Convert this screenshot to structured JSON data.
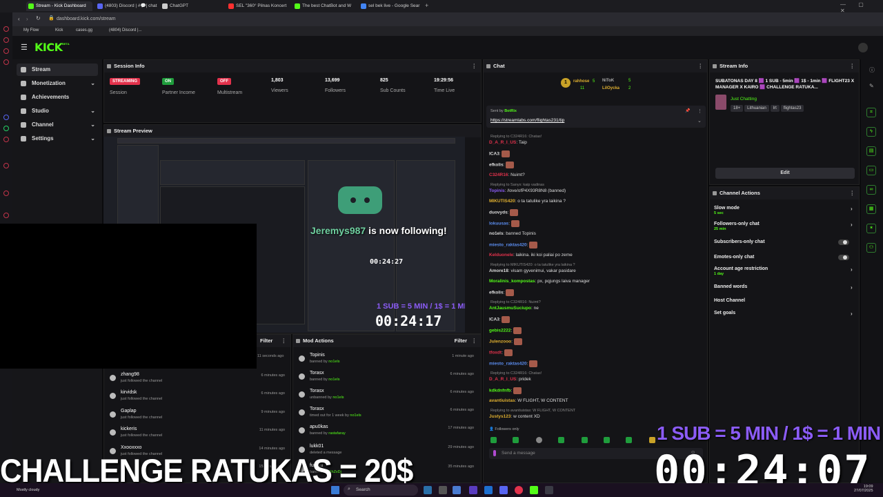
{
  "browser": {
    "tabs": [
      {
        "label": "Stream - Kick Dashboard",
        "active": true,
        "color": "#53fc18"
      },
      {
        "label": "(4803) Discord | #💬| chat",
        "active": false,
        "color": "#5865f2"
      },
      {
        "label": "ChatGPT",
        "active": false,
        "color": "#cccccc"
      },
      {
        "label": "SEL \"360° Pilnas Koncert",
        "active": false,
        "color": "#ff3030"
      },
      {
        "label": "The best ChatBot and W",
        "active": false,
        "color": "#53fc18"
      },
      {
        "label": "sel bek live - Google Sear",
        "active": false,
        "color": "#4285f4"
      }
    ],
    "url": "dashboard.kick.com/stream",
    "bookmarks": [
      "My Flow",
      "Kick",
      "cases.gg",
      "(4804) Discord |..."
    ]
  },
  "header": {
    "logo": "KICK",
    "logo_sup": "BETA"
  },
  "nav": {
    "items": [
      {
        "label": "Stream",
        "active": true,
        "chevron": false
      },
      {
        "label": "Monetization",
        "active": false,
        "chevron": true
      },
      {
        "label": "Achievements",
        "active": false,
        "chevron": false
      },
      {
        "label": "Studio",
        "active": false,
        "chevron": true
      },
      {
        "label": "Channel",
        "active": false,
        "chevron": true
      },
      {
        "label": "Settings",
        "active": false,
        "chevron": true
      }
    ]
  },
  "session": {
    "title": "Session Info",
    "stats": [
      {
        "badge": "STREAMING",
        "badge_color": "#e3324c",
        "label": "Session"
      },
      {
        "badge": "ON",
        "badge_color": "#1f9d3c",
        "label": "Partner Income"
      },
      {
        "badge": "OFF",
        "badge_color": "#e3324c",
        "label": "Multistream"
      },
      {
        "value": "1,803",
        "label": "Viewers"
      },
      {
        "value": "13,699",
        "label": "Followers"
      },
      {
        "value": "825",
        "label": "Sub Counts"
      },
      {
        "value": "19:29:56",
        "label": "Time Live"
      }
    ]
  },
  "preview": {
    "title": "Stream Preview",
    "alert_user": "Jeremys987",
    "alert_text": "is now following!",
    "alert_time": "00:24:27",
    "rule": "1 SUB = 5 MIN / 1$ = 1 MIN",
    "timer": "00:24:17"
  },
  "chat": {
    "title": "Chat",
    "top_users": [
      {
        "name": "rahhose",
        "count": "5"
      },
      {
        "name": "NiToK",
        "count": "5"
      },
      {
        "name": "",
        "count": "11"
      },
      {
        "name": "LilOycka",
        "count": "2"
      }
    ],
    "pinned": {
      "sent_by": "Sent by",
      "sender": "BotRix",
      "link": "https://streamlabs.com/flightas231/tip"
    },
    "messages": [
      {
        "reply": "Replying to C324R16: Chatas!",
        "user": "D_A_R_I_US",
        "color": "#e3324c",
        "text": "Taip"
      },
      {
        "user": "ICA3",
        "color": "#dddddd",
        "text": ""
      },
      {
        "user": "efkolis",
        "color": "#dddddd",
        "text": ""
      },
      {
        "user": "C324R16",
        "color": "#e3324c",
        "text": "Nuimt?"
      },
      {
        "reply": "Replying to Sanyx: kaip vadinas",
        "user": "Topinis",
        "color": "#8b5cf6",
        "text": "/love/ofP4X93R8N8 (banned)"
      },
      {
        "user": "MIKUTIS420",
        "color": "#e0b030",
        "text": "o ta tatulike yra laikina ?"
      },
      {
        "user": "duovyds",
        "color": "#dddddd",
        "text": ""
      },
      {
        "user": "lokuusas",
        "color": "#5b8def",
        "text": ""
      },
      {
        "user": "no1els",
        "color": "#dddddd",
        "text": "banned Topinis"
      },
      {
        "user": "miesto_raktas420",
        "color": "#5b8def",
        "text": ""
      },
      {
        "user": "Kelduonele",
        "color": "#e3324c",
        "text": "laikina. iki koi paliai po zeme"
      },
      {
        "reply": "Replying to MIKUTIS420: o ta tatulike yra laikina ?",
        "user": "Amore18",
        "color": "#dddddd",
        "text": "visam gyvenimui, vakar pasidare"
      },
      {
        "user": "Moralinis_kompostas",
        "color": "#53fc18",
        "text": "px, pqjungs laiva manager"
      },
      {
        "user": "efkolis",
        "color": "#dddddd",
        "text": ""
      },
      {
        "reply": "Replying to C324R16: Nuimt?",
        "user": "AntJausmuSuciupo",
        "color": "#53fc18",
        "text": "ne"
      },
      {
        "user": "ICA3",
        "color": "#dddddd",
        "text": ""
      },
      {
        "user": "gebis2222",
        "color": "#53fc18",
        "text": ""
      },
      {
        "user": "Julenzooo",
        "color": "#e0b030",
        "text": ""
      },
      {
        "user": "tfoxdt",
        "color": "#e3324c",
        "text": ""
      },
      {
        "user": "miesto_raktas420",
        "color": "#5b8def",
        "text": ""
      },
      {
        "reply": "Replying to C324R16: Chatas!",
        "user": "D_A_R_I_US",
        "color": "#e3324c",
        "text": "pridek"
      },
      {
        "user": "kdkdnfnfb",
        "color": "#53fc18",
        "text": ""
      },
      {
        "user": "avantiuistas",
        "color": "#e0b030",
        "text": "W FLIGHT, W CONTENT"
      },
      {
        "reply": "Replying to avantiuistas: W FLIGHT, W CONTENT",
        "user": "Justys123",
        "color": "#e0b030",
        "text": "w content XD"
      }
    ],
    "followers_only": "Followers only",
    "input_placeholder": "Send a message"
  },
  "stream_info": {
    "title": "Stream Info",
    "stream_title": "SUBATONAS DAY 8 🟪 1 SUB - 5min 🟪 1$ - 1min 🟪 FLIGHT23 X MANAGER X KAIRO 🟪 CHALLENGE RATUKA...",
    "category": "Just Chatting",
    "tags": [
      "18+",
      "Lithuanian",
      "lrt",
      "flightas23"
    ],
    "edit": "Edit"
  },
  "channel_actions": {
    "title": "Channel Actions",
    "items": [
      {
        "label": "Slow mode",
        "sub": "5 sec",
        "control": "arrow"
      },
      {
        "label": "Followers-only chat",
        "sub": "25 min",
        "control": "arrow"
      },
      {
        "label": "Subscribers-only chat",
        "sub": "",
        "control": "toggle"
      },
      {
        "label": "Emotes-only chat",
        "sub": "",
        "control": "toggle"
      },
      {
        "label": "Account age restriction",
        "sub": "1 day",
        "control": "arrow"
      },
      {
        "label": "Banned words",
        "sub": "",
        "control": "arrow"
      },
      {
        "label": "Host Channel",
        "sub": "",
        "control": "none"
      },
      {
        "label": "Set goals",
        "sub": "",
        "control": "arrow"
      }
    ]
  },
  "activity_feed": {
    "filter": "Filter",
    "first_time": "11 seconds ago",
    "items": [
      {
        "name": "zhang98",
        "desc": "just followed the channel",
        "time": "6 minutes ago"
      },
      {
        "name": "kirvidsk",
        "desc": "just followed the channel",
        "time": "6 minutes ago"
      },
      {
        "name": "Gaplap",
        "desc": "just followed the channel",
        "time": "9 minutes ago"
      },
      {
        "name": "kickeris",
        "desc": "just followed the channel",
        "time": "11 minutes ago"
      },
      {
        "name": "Xxooxxxo",
        "desc": "just followed the channel",
        "time": "14 minutes ago"
      },
      {
        "name": "",
        "desc": "",
        "time": "15 minutes ago"
      }
    ]
  },
  "mod_actions": {
    "title": "Mod Actions",
    "filter": "Filter",
    "items": [
      {
        "name": "Topinis",
        "desc": "banned by",
        "by": "no1els",
        "time": "1 minute ago"
      },
      {
        "name": "Torasx",
        "desc": "banned by",
        "by": "no1els",
        "time": "6 minutes ago"
      },
      {
        "name": "Torasx",
        "desc": "unbanned by",
        "by": "no1els",
        "time": "6 minutes ago"
      },
      {
        "name": "Torasx",
        "desc": "timed out for 1 week by",
        "by": "no1els",
        "time": "6 minutes ago"
      },
      {
        "name": "apu0kas",
        "desc": "banned by",
        "by": "rastafaray",
        "time": "17 minutes ago"
      },
      {
        "name": "lukk01",
        "desc": "deleted a message",
        "by": "",
        "time": "29 minutes ago"
      },
      {
        "name": "furlani",
        "desc": "banned by",
        "by": "GhZvDj",
        "time": "35 minutes ago"
      }
    ]
  },
  "overlay": {
    "challenge": "CHALLENGE RATUKAS = 20$",
    "rule": "1 SUB = 5 MIN / 1$ = 1 MIN",
    "timer": "00:24:07"
  },
  "taskbar": {
    "weather": "Mostly cloudy",
    "search": "Search",
    "clock_time": "19:09",
    "clock_date": "27/07/2025"
  }
}
